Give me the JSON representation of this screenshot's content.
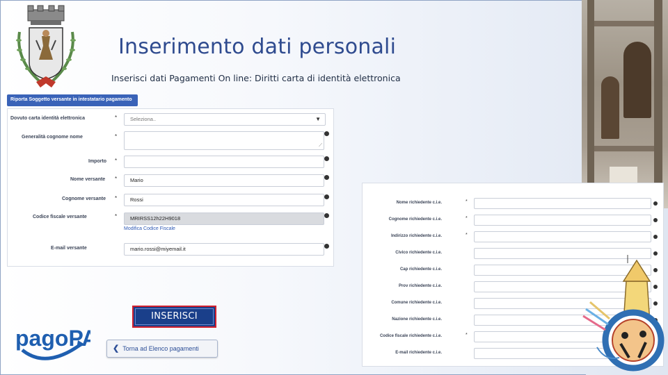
{
  "page": {
    "title": "Inserimento dati personali",
    "subtitle": "Inserisci dati Pagamenti On line: Diritti carta di identità elettronica"
  },
  "riporta_button": "Riporta Soggetto versante in intestatario pagamento",
  "left_form": {
    "fields": [
      {
        "label": "Dovuto carta identità  elettronica",
        "required": "*",
        "value": "Seleziona..",
        "type": "select"
      },
      {
        "label": "Generalità  cognome nome",
        "required": "*",
        "value": "",
        "type": "textarea"
      },
      {
        "label": "Importo",
        "required": "*",
        "value": "",
        "type": "text"
      },
      {
        "label": "Nome versante",
        "required": "*",
        "value": "Mario",
        "type": "text"
      },
      {
        "label": "Cognome versante",
        "required": "*",
        "value": "Rossi",
        "type": "text"
      },
      {
        "label": "Codice fiscale versante",
        "required": "*",
        "value": "MRIRSS12h22H9018",
        "type": "readonly"
      },
      {
        "label": "E-mail versante",
        "required": "",
        "value": "mario.rossi@miyemail.it",
        "type": "text"
      }
    ],
    "modifica_link": "Modifica Codice Fiscale"
  },
  "inserisci_button": "INSERISCI",
  "torna_button": {
    "icon": "chevron-left",
    "label": "Torna ad Elenco pagamenti"
  },
  "logo": {
    "text": "pagoPA",
    "color": "#1f5fb0"
  },
  "right_form": {
    "fields": [
      {
        "label": "Nome richiedente c.i.e.",
        "required": "*"
      },
      {
        "label": "Cognome richiedente c.i.e.",
        "required": "*"
      },
      {
        "label": "Indirizzo richiedente c.i.e.",
        "required": "*"
      },
      {
        "label": "Civico richiedente c.i.e.",
        "required": ""
      },
      {
        "label": "Cap richiedente c.i.e.",
        "required": ""
      },
      {
        "label": "Prov richiedente c.i.e.",
        "required": ""
      },
      {
        "label": "Comune richiedente c.i.e.",
        "required": ""
      },
      {
        "label": "Nazione richiedente c.i.e.",
        "required": ""
      },
      {
        "label": "Codice fiscale richiedente c.i.e.",
        "required": "*"
      },
      {
        "label": "E-mail richiedente c.i.e.",
        "required": ""
      }
    ]
  },
  "colors": {
    "title": "#2f4b8f",
    "primary_button": "#1a3f8a",
    "button_border": "#d21f2c",
    "link": "#2f5ab5"
  }
}
